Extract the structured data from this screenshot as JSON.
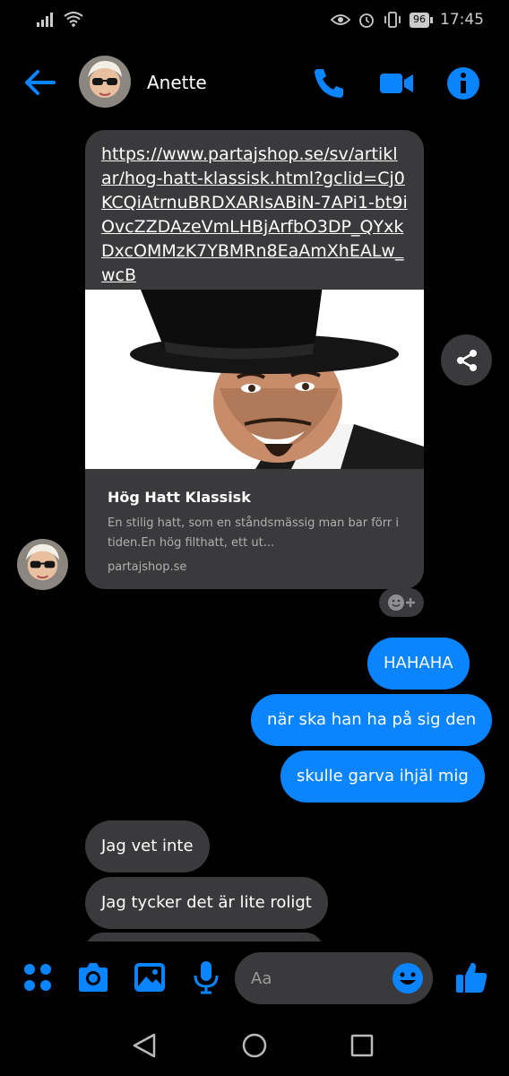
{
  "status_bar": {
    "time": "17:45",
    "battery": "96"
  },
  "header": {
    "contact_name": "Anette"
  },
  "link_card": {
    "url": "https://www.partajshop.se/sv/artiklar/hog-hatt-klassisk.html?gclid=Cj0KCQiAtrnuBRDXARIsABiN-7APi1-bt9iOvcZZDAzeVmLHBjArfbO3DP_QYxkDxcOMMzK7YBMRn8EaAmXhEALw_wcB",
    "title": "Hög Hatt Klassisk",
    "description": "En stilig hatt, som en ståndsmässig man bar förr i tiden.En hög filthatt, ett ut...",
    "domain": "partajshop.se"
  },
  "messages": [
    {
      "dir": "out",
      "text": "HAHAHA"
    },
    {
      "dir": "out",
      "text": "när ska han ha på sig den"
    },
    {
      "dir": "out",
      "text": "skulle garva ihjäl mig"
    },
    {
      "dir": "in",
      "text": "Jag vet inte"
    },
    {
      "dir": "in",
      "text": "Jag tycker det är lite roligt"
    }
  ],
  "composer": {
    "placeholder": "Aa"
  },
  "colors": {
    "accent": "#0a84ff",
    "bubble_in": "#3a3a3c",
    "background": "#000000"
  }
}
